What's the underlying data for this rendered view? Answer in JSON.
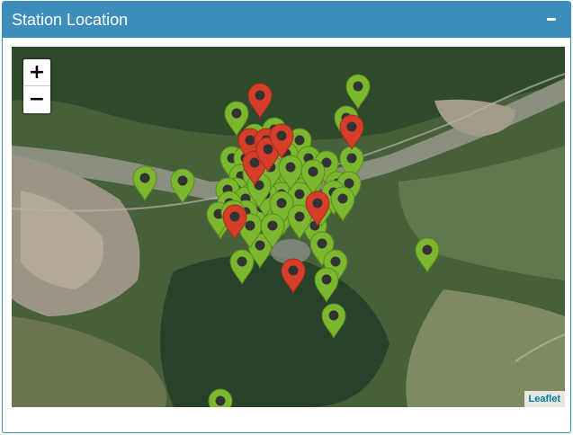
{
  "panel": {
    "title": "Station Location",
    "collapse_icon": "minus-icon"
  },
  "map": {
    "zoom_in_label": "+",
    "zoom_out_label": "−",
    "attribution": "Leaflet",
    "colors": {
      "active_marker": "#7cb82f",
      "alert_marker": "#d63e2a",
      "header": "#3c8dbc"
    },
    "markers": {
      "count_green": 58,
      "count_red": 10
    }
  }
}
